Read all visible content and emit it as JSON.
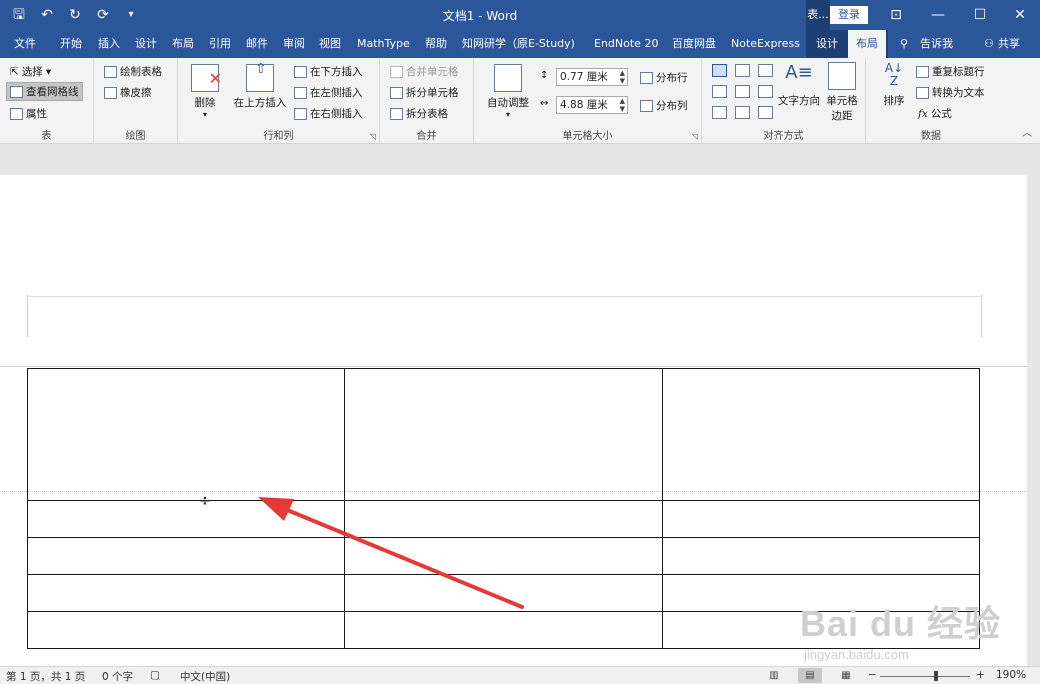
{
  "titlebar": {
    "title": "文档1 - Word",
    "context_label": "表...",
    "login_label": "登录",
    "qat_icons": [
      "save-icon",
      "undo-icon",
      "redo-icon",
      "refresh-icon",
      "customize-icon"
    ],
    "window_controls": [
      "ribbon-display-icon",
      "minimize-icon",
      "maximize-icon",
      "close-icon"
    ]
  },
  "tabs": [
    {
      "label": "文件"
    },
    {
      "label": "开始"
    },
    {
      "label": "插入"
    },
    {
      "label": "设计"
    },
    {
      "label": "布局"
    },
    {
      "label": "引用"
    },
    {
      "label": "邮件"
    },
    {
      "label": "审阅"
    },
    {
      "label": "视图"
    },
    {
      "label": "MathType"
    },
    {
      "label": "帮助"
    },
    {
      "label": "知网研学（原E-Study)"
    },
    {
      "label": "EndNote 20"
    },
    {
      "label": "百度网盘"
    },
    {
      "label": "NoteExpress"
    },
    {
      "label": "设计"
    },
    {
      "label": "布局"
    },
    {
      "label": "告诉我"
    },
    {
      "label": "共享"
    }
  ],
  "ribbon": {
    "table_group": {
      "label": "表",
      "select": "选择",
      "gridlines": "查看网格线",
      "properties": "属性"
    },
    "draw_group": {
      "label": "绘图",
      "draw_table": "绘制表格",
      "eraser": "橡皮擦"
    },
    "rows_cols_group": {
      "label": "行和列",
      "delete": "删除",
      "insert_above": "在上方插入",
      "insert_below": "在下方插入",
      "insert_left": "在左侧插入",
      "insert_right": "在右侧插入"
    },
    "merge_group": {
      "label": "合并",
      "merge_cells": "合并单元格",
      "split_cells": "拆分单元格",
      "split_table": "拆分表格"
    },
    "cell_size_group": {
      "label": "单元格大小",
      "autofit": "自动调整",
      "height_value": "0.77 厘米",
      "width_value": "4.88 厘米",
      "distribute_rows": "分布行",
      "distribute_cols": "分布列"
    },
    "alignment_group": {
      "label": "对齐方式",
      "text_direction": "文字方向",
      "cell_margins_1": "单元格",
      "cell_margins_2": "边距"
    },
    "data_group": {
      "label": "数据",
      "sort": "排序",
      "repeat_header": "重复标题行",
      "convert_text": "转换为文本",
      "formula": "公式"
    }
  },
  "document": {
    "table": {
      "rows": 5,
      "cols": 3
    }
  },
  "watermark": {
    "main": "Bai du 经验",
    "sub": "jingyan.baidu.com"
  },
  "statusbar": {
    "page": "第 1 页，共 1 页",
    "words": "0 个字",
    "language": "中文(中国)",
    "zoom_minus": "−",
    "zoom_plus": "+",
    "zoom": "190%"
  },
  "colors": {
    "accent": "#2b579a",
    "annotation_arrow": "#e53935"
  }
}
